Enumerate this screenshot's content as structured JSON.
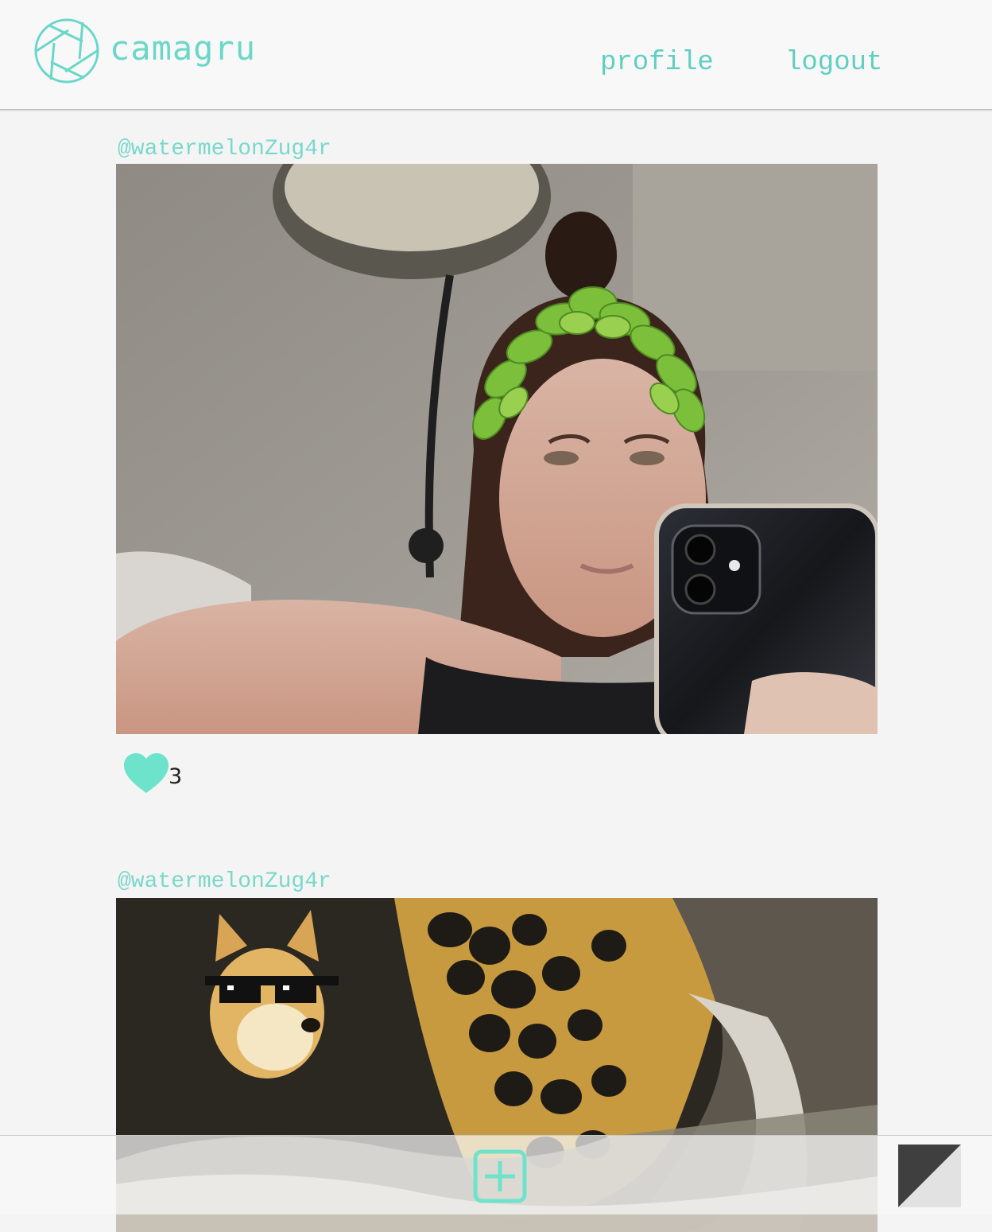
{
  "app": {
    "name": "camagru",
    "brand_color": "#6ad7c9"
  },
  "nav": {
    "profile_label": "profile",
    "logout_label": "logout"
  },
  "posts": [
    {
      "username": "@watermelonZug4r",
      "photo": "selfie with phone, leaf crown sticker",
      "likes": "3",
      "liked": true
    },
    {
      "username": "@watermelonZug4r",
      "photo": "black and gold fluid art, doge with pixel sunglasses sticker"
    }
  ],
  "footer": {
    "add_icon": "plus-square-icon",
    "theme_icon": "theme-toggle-icon"
  }
}
